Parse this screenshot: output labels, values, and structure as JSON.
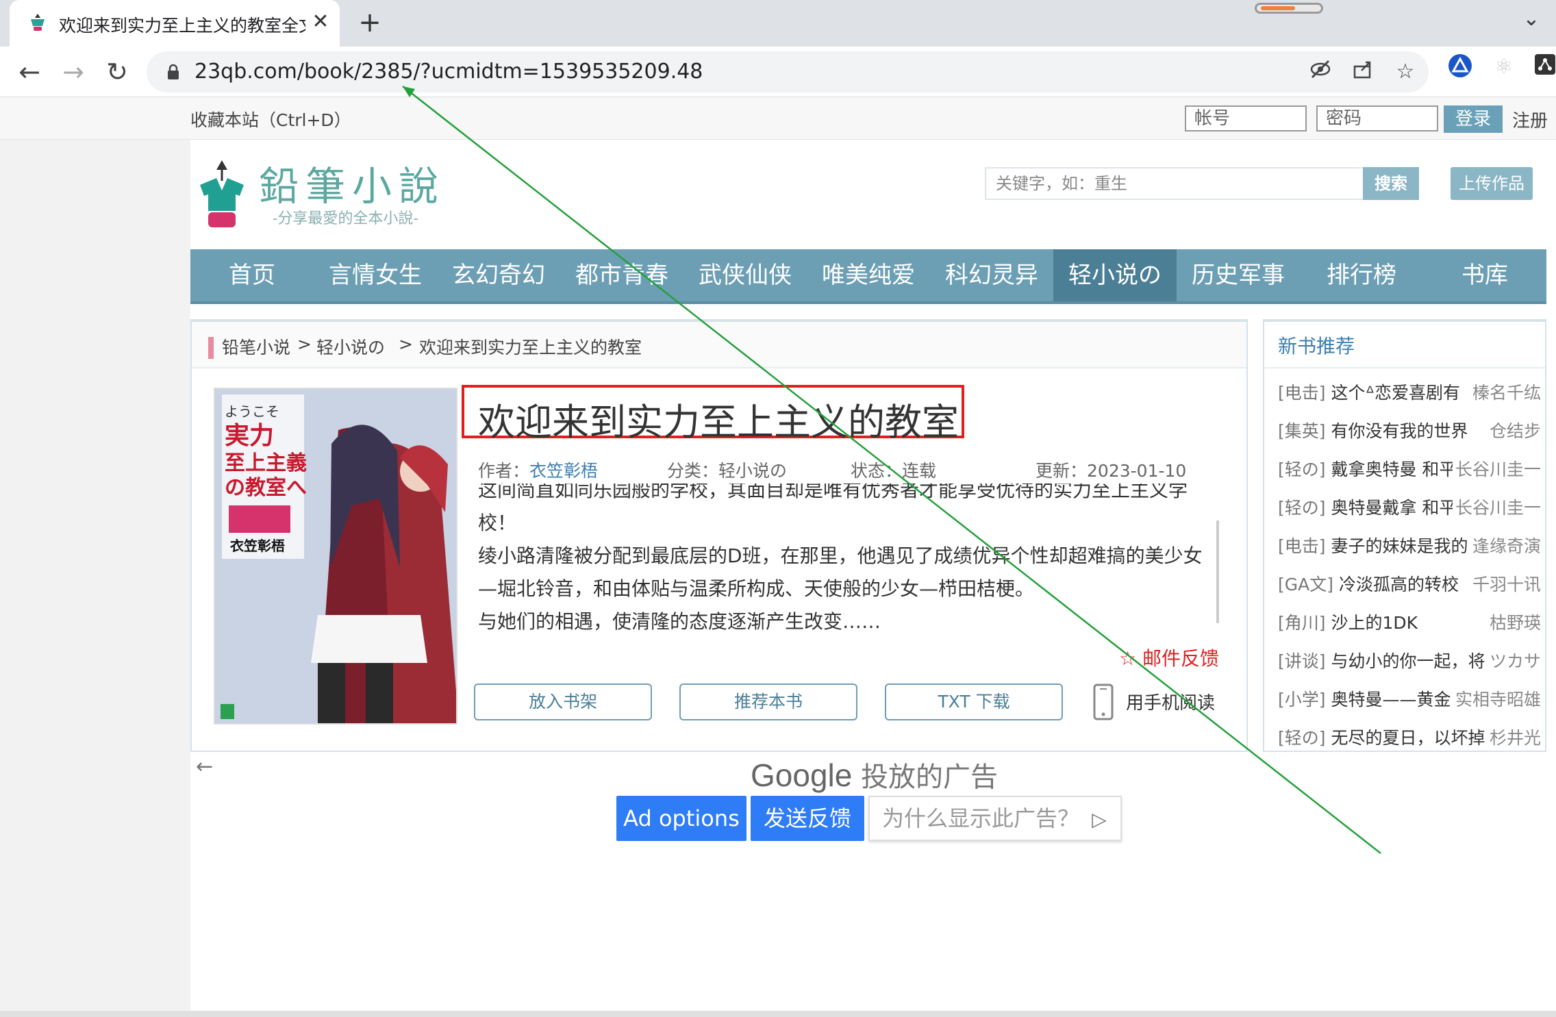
{
  "browser": {
    "tab_title": "欢迎来到实力至上主义的教室全文",
    "close_symbol": "✕",
    "new_tab_symbol": "+",
    "url": "23qb.com/book/2385/?ucmidtm=1539535209.48"
  },
  "topbar": {
    "bookmark_text": "收藏本站（Ctrl+D）",
    "account_placeholder": "帐号",
    "password_placeholder": "密码",
    "login_label": "登录",
    "register_label": "注册"
  },
  "header": {
    "logo_title": "鉛筆小說",
    "logo_slogan": "-分享最愛的全本小說-",
    "search_placeholder": "关键字，如：重生",
    "search_label": "搜索",
    "upload_label": "上传作品"
  },
  "nav": {
    "items": [
      "首页",
      "言情女生",
      "玄幻奇幻",
      "都市青春",
      "武侠仙侠",
      "唯美纯爱",
      "科幻灵异",
      "轻小说の",
      "历史军事",
      "排行榜",
      "书库"
    ],
    "active_index": 7
  },
  "breadcrumb": {
    "home": "铅笔小说",
    "sep": ">",
    "category": "轻小说の",
    "current": "欢迎来到实力至上主义的教室"
  },
  "book": {
    "title": "欢迎来到实力至上主义的教室",
    "author_label": "作者：",
    "author": "衣笠彰梧",
    "category_label": "分类：",
    "category": "轻小说の",
    "status_label": "状态：",
    "status": "连载",
    "updated_label": "更新：",
    "updated": "2023-01-10",
    "cover_title_jp": "ようこそ実力至上主義の教室へ",
    "cover_author_jp": "衣笠彰梧",
    "description": [
      "这间简直如同乐园般的学校，其面目却是唯有优秀者才能享受优待的实力至上主义学",
      "校！",
      "绫小路清隆被分配到最底层的D班，在那里，他遇见了成绩优异个性却超难搞的美少女",
      "—堀北铃音，和由体贴与温柔所构成、天使般的少女—栉田桔梗。",
      "与她们的相遇，使清隆的态度逐渐产生改变……"
    ],
    "mail_feedback": "☆ 邮件反馈",
    "buttons": {
      "shelf": "放入书架",
      "recommend": "推荐本书",
      "download": "TXT 下载",
      "mobile": "用手机阅读"
    }
  },
  "sidebar": {
    "title": "新书推荐",
    "items": [
      {
        "tag": "[电击]",
        "book": "这个ᐞ恋爱喜剧有",
        "author": "榛名千纮"
      },
      {
        "tag": "[集英]",
        "book": "有你没有我的世界",
        "author": "仓结步"
      },
      {
        "tag": "[轻の]",
        "book": "戴拿奥特曼 和平",
        "author": "长谷川圭一"
      },
      {
        "tag": "[轻の]",
        "book": "奥特曼戴拿 和平",
        "author": "长谷川圭一"
      },
      {
        "tag": "[电击]",
        "book": "妻子的妹妹是我的",
        "author": "逢缘奇演"
      },
      {
        "tag": "[GA文]",
        "book": "冷淡孤高的转校",
        "author": "千羽十讯"
      },
      {
        "tag": "[角川]",
        "book": "沙上的1DK",
        "author": "枯野瑛"
      },
      {
        "tag": "[讲谈]",
        "book": "与幼小的你一起，将",
        "author": "ツカサ"
      },
      {
        "tag": "[小学]",
        "book": "奥特曼——黄金",
        "author": "实相寺昭雄"
      },
      {
        "tag": "[轻の]",
        "book": "无尽的夏日，以坏掉",
        "author": "杉井光"
      }
    ]
  },
  "ad": {
    "back_symbol": "←",
    "brand": "Google",
    "brand_suffix": "投放的广告",
    "options_label": "Ad options",
    "feedback_label": "发送反馈",
    "why_label": "为什么显示此广告？"
  },
  "colors": {
    "accent": "#6d9fb4",
    "accent_dark": "#4b7f96",
    "title_border": "#e02020",
    "ad_blue": "#2e7cf6",
    "annotation_line": "#22a03a"
  }
}
